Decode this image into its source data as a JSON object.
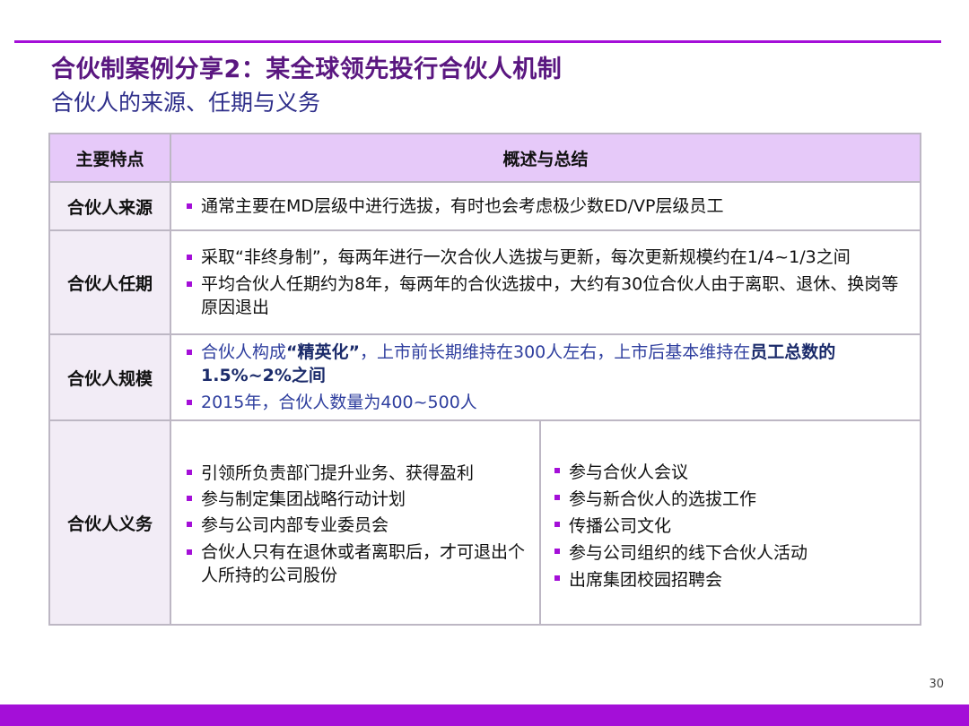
{
  "title": "合伙制案例分享2：某全球领先投行合伙人机制",
  "subtitle": "合伙人的来源、任期与义务",
  "colors": {
    "accent": "#a40fd8",
    "header_bg": "#e6c9f9",
    "label_bg": "#f2ecf6",
    "title": "#5a1780",
    "blue_text": "#2e3e9e"
  },
  "table": {
    "headers": [
      "主要特点",
      "概述与总结"
    ],
    "rows": {
      "source": {
        "label": "合伙人来源",
        "items": [
          "通常主要在MD层级中进行选拔，有时也会考虑极少数ED/VP层级员工"
        ]
      },
      "term": {
        "label": "合伙人任期",
        "items": [
          "采取“非终身制”，每两年进行一次合伙人选拔与更新，每次更新规模约在1/4~1/3之间",
          "平均合伙人任期约为8年，每两年的合伙选拔中，大约有30位合伙人由于离职、退休、换岗等原因退出"
        ]
      },
      "scale": {
        "label": "合伙人规模",
        "item1_pre": "合伙人构成",
        "item1_em1": "“精英化”",
        "item1_mid": "，上市前长期维持在300人左右，上市后基本维持在",
        "item1_em2": "员工总数的1.5%~2%之间",
        "item2": "2015年，合伙人数量为400~500人"
      },
      "duties": {
        "label": "合伙人义务",
        "left": [
          "引领所负责部门提升业务、获得盈利",
          "参与制定集团战略行动计划",
          "参与公司内部专业委员会",
          "合伙人只有在退休或者离职后，才可退出个人所持的公司股份"
        ],
        "right": [
          "参与合伙人会议",
          "参与新合伙人的选拔工作",
          "传播公司文化",
          "参与公司组织的线下合伙人活动",
          "出席集团校园招聘会"
        ]
      }
    }
  },
  "page_number": "30"
}
